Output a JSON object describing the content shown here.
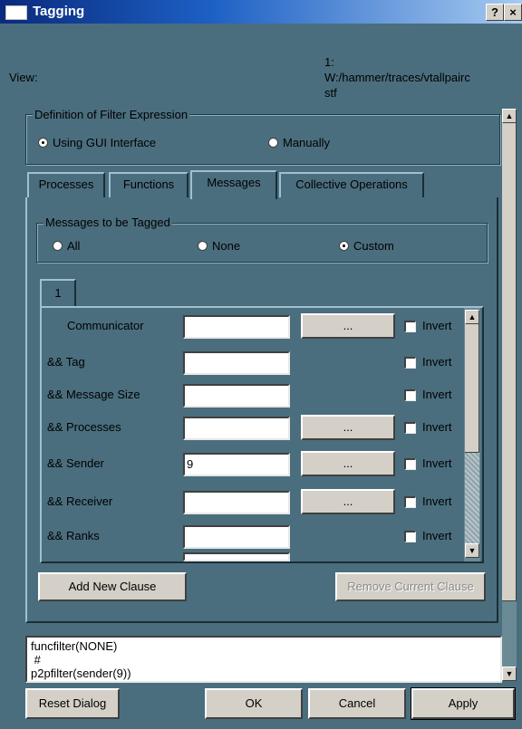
{
  "window": {
    "title": "Tagging",
    "help_button": "?",
    "close_button": "×"
  },
  "view": {
    "label": "View:",
    "value_line1": "1:",
    "value_line2": "W:/hammer/traces/vtallpairc",
    "value_line3": "stf"
  },
  "definition": {
    "legend": "Definition of Filter Expression",
    "options": [
      {
        "label": "Using GUI Interface",
        "selected": true
      },
      {
        "label": "Manually",
        "selected": false
      }
    ]
  },
  "tabs": [
    {
      "label": "Processes",
      "active": false
    },
    {
      "label": "Functions",
      "active": false
    },
    {
      "label": "Messages",
      "active": true
    },
    {
      "label": "Collective Operations",
      "active": false
    }
  ],
  "messages": {
    "legend": "Messages to be Tagged",
    "options": [
      {
        "label": "All",
        "selected": false
      },
      {
        "label": "None",
        "selected": false
      },
      {
        "label": "Custom",
        "selected": true
      }
    ]
  },
  "clause_tab": {
    "label": "1"
  },
  "rows": [
    {
      "label": "Communicator",
      "value": "",
      "has_button": true,
      "button_label": "...",
      "invert_label": "Invert"
    },
    {
      "label": "&& Tag",
      "value": "",
      "has_button": false,
      "button_label": "",
      "invert_label": "Invert"
    },
    {
      "label": "&& Message Size",
      "value": "",
      "has_button": false,
      "button_label": "",
      "invert_label": "Invert"
    },
    {
      "label": "&& Processes",
      "value": "",
      "has_button": true,
      "button_label": "...",
      "invert_label": "Invert"
    },
    {
      "label": "&& Sender",
      "value": "9",
      "has_button": true,
      "button_label": "...",
      "invert_label": "Invert"
    },
    {
      "label": "&& Receiver",
      "value": "",
      "has_button": true,
      "button_label": "...",
      "invert_label": "Invert"
    },
    {
      "label": "&& Ranks",
      "value": "",
      "has_button": false,
      "button_label": "",
      "invert_label": "Invert"
    }
  ],
  "clause_buttons": {
    "add": "Add New Clause",
    "remove": "Remove Current Clause"
  },
  "expression": {
    "line1": "funcfilter(NONE)",
    "line2": " #",
    "line3": "p2pfilter(sender(9))"
  },
  "footer": {
    "reset": "Reset Dialog",
    "ok": "OK",
    "cancel": "Cancel",
    "apply": "Apply"
  },
  "colors": {
    "dialog_bg": "#4a6e7e",
    "title_bar": "#0a2a7c",
    "button_face": "#d4d0c8"
  }
}
